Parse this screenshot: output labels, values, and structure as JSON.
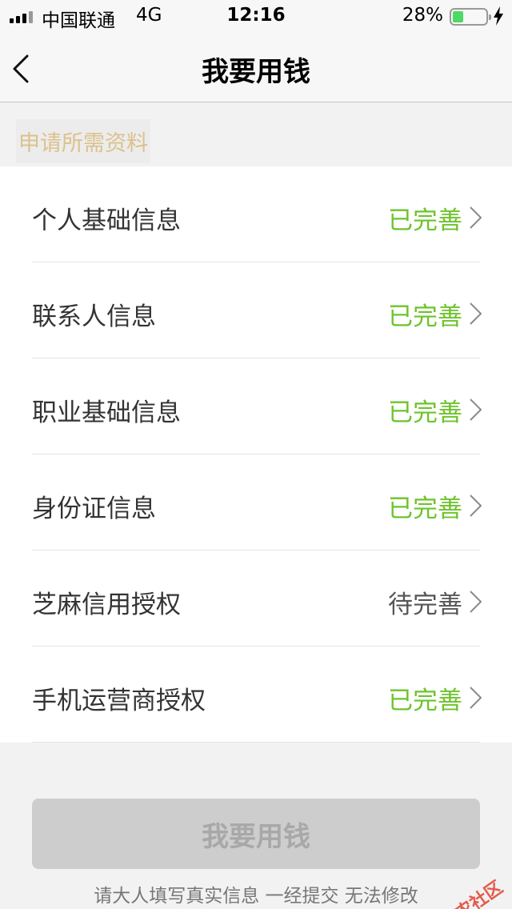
{
  "status_bar": {
    "carrier": "中国联通",
    "network": "4G",
    "time": "12:16",
    "battery": "28%",
    "battery_level": 0.28
  },
  "nav": {
    "title": "我要用钱"
  },
  "section": {
    "title": "申请所需资料"
  },
  "items": [
    {
      "label": "个人基础信息",
      "status": "已完善",
      "state": "done"
    },
    {
      "label": "联系人信息",
      "status": "已完善",
      "state": "done"
    },
    {
      "label": "职业基础信息",
      "status": "已完善",
      "state": "done"
    },
    {
      "label": "身份证信息",
      "status": "已完善",
      "state": "done"
    },
    {
      "label": "芝麻信用授权",
      "status": "待完善",
      "state": "pending"
    },
    {
      "label": "手机运营商授权",
      "status": "已完善",
      "state": "done"
    }
  ],
  "submit": {
    "label": "我要用钱"
  },
  "notice": "请大人填写真实信息 一经提交 无法修改",
  "watermark": "卡农社区",
  "colors": {
    "done": "#6cc42b",
    "pending": "#555555",
    "section_title": "#dcc18c",
    "button_disabled": "#cdcdcd"
  }
}
